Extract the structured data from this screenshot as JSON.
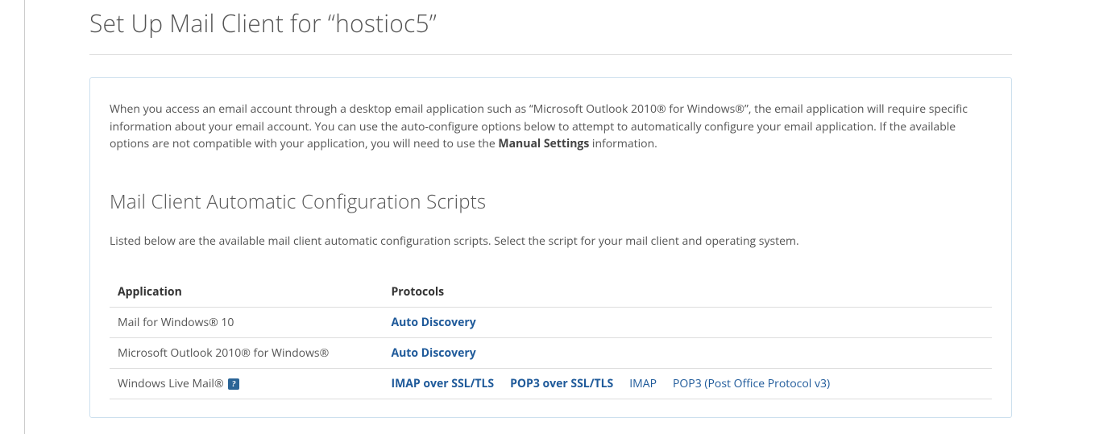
{
  "pageTitle": "Set Up Mail Client for “hostioc5”",
  "intro": {
    "pre": "When you access an email account through a desktop email application such as “Microsoft Outlook 2010® for Windows®”, the email application will require specific information about your email account. You can use the auto-configure options below to attempt to automatically configure your email application. If the available options are not compatible with your application, you will need to use the ",
    "strong": "Manual Settings",
    "post": " information."
  },
  "sectionTitle": "Mail Client Automatic Configuration Scripts",
  "sectionDesc": "Listed below are the available mail client automatic configuration scripts. Select the script for your mail client and operating system.",
  "table": {
    "headers": {
      "application": "Application",
      "protocols": "Protocols"
    },
    "rows": [
      {
        "app": "Mail for Windows® 10",
        "help": false,
        "protocols": [
          {
            "label": "Auto Discovery",
            "bold": true
          }
        ]
      },
      {
        "app": "Microsoft Outlook 2010® for Windows®",
        "help": false,
        "protocols": [
          {
            "label": "Auto Discovery",
            "bold": true
          }
        ]
      },
      {
        "app": "Windows Live Mail®",
        "help": true,
        "protocols": [
          {
            "label": "IMAP over SSL/TLS",
            "bold": true
          },
          {
            "label": "POP3 over SSL/TLS",
            "bold": true
          },
          {
            "label": "IMAP",
            "bold": false
          },
          {
            "label": "POP3 (Post Office Protocol v3)",
            "bold": false
          }
        ]
      }
    ]
  }
}
